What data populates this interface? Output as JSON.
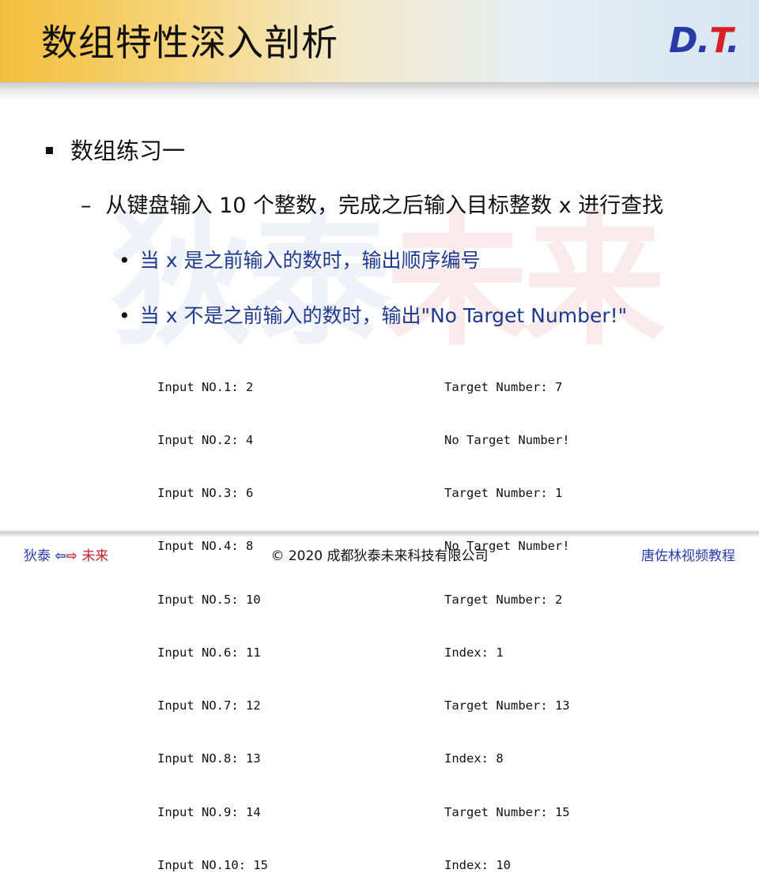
{
  "header": {
    "title": "数组特性深入剖析",
    "logo": {
      "d": "D",
      "dot1": ".",
      "t": "T",
      "dot2": "."
    }
  },
  "watermark": {
    "part1": "狄泰",
    "part2": "未来"
  },
  "content": {
    "bullet1": "数组练习一",
    "bullet2": {
      "dash": "–",
      "text": "从键盘输入 10 个整数，完成之后输入目标整数  x 进行查找"
    },
    "bullet3": {
      "dot": "•",
      "text": "当 x 是之前输入的数时，输出顺序编号"
    },
    "bullet4": {
      "dot": "•",
      "text": "当 x 不是之前输入的数时，输出\"No Target Number!\""
    }
  },
  "code": {
    "left": [
      "Input NO.1: 2",
      "Input NO.2: 4",
      "Input NO.3: 6",
      "Input NO.4: 8",
      "Input NO.5: 10",
      "Input NO.6: 11",
      "Input NO.7: 12",
      "Input NO.8: 13",
      "Input NO.9: 14",
      "Input NO.10: 15"
    ],
    "right": [
      "Target Number: 7",
      "No Target Number!",
      "Target Number: 1",
      "No Target Number!",
      "Target Number: 2",
      "Index: 1",
      "Target Number: 13",
      "Index: 8",
      "Target Number: 15",
      "Index: 10"
    ]
  },
  "footer": {
    "left_a": "狄泰",
    "arrow_left": "⇦",
    "arrow_right": "⇨",
    "left_b": "未来",
    "center": "© 2020 成都狄泰未来科技有限公司",
    "right": "唐佐林视频教程"
  },
  "colors": {
    "brand_blue": "#2a3aa8",
    "brand_red": "#c0202a",
    "sub_bullet_text": "#1f3a8c"
  }
}
